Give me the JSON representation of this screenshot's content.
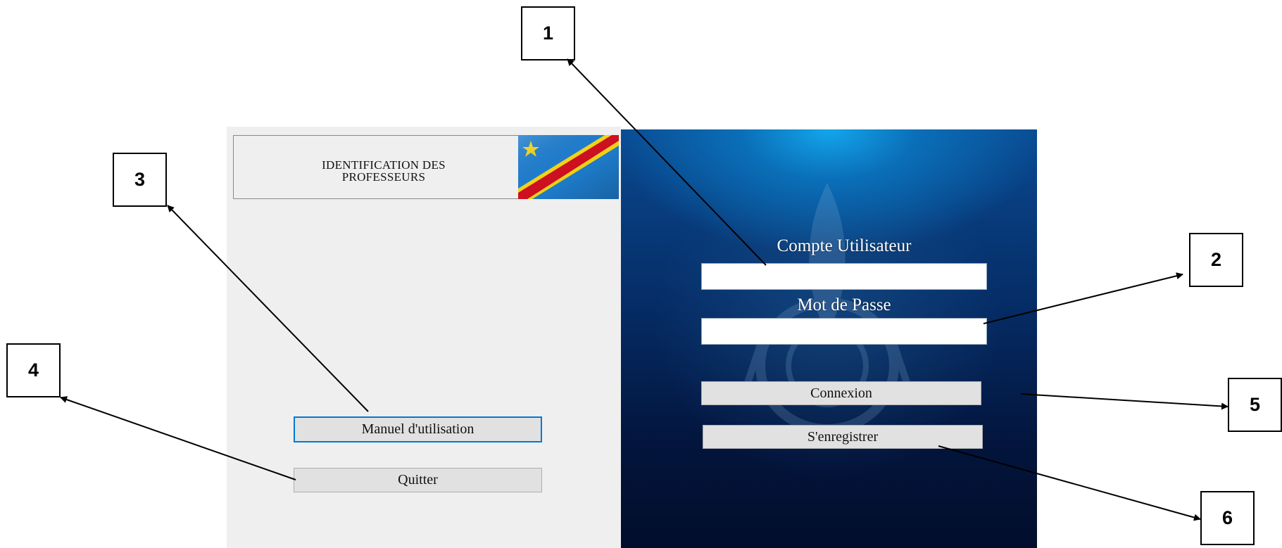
{
  "window": {
    "title_text": "IDENTIFICATION  DES\nPROFESSEURS"
  },
  "login": {
    "user_label": "Compte Utilisateur",
    "password_label": "Mot de Passe",
    "user_value": "",
    "password_value": ""
  },
  "buttons": {
    "connexion": "Connexion",
    "register": "S'enregistrer",
    "manual": "Manuel d'utilisation",
    "quit": "Quitter"
  },
  "callouts": [
    "1",
    "2",
    "3",
    "4",
    "5",
    "6"
  ],
  "colors": {
    "panel_bg": "#efefef",
    "right_panel_top": "#13a6ec",
    "right_panel_bottom": "#020d2b",
    "flag_blue": "#1f7fd1",
    "flag_star": "#f7d618",
    "flag_stripe_red": "#ce1021",
    "focus_border": "#0078d7"
  },
  "icons": {
    "flag": "drc-flag-icon",
    "emblem": "emblem-watermark-icon"
  }
}
